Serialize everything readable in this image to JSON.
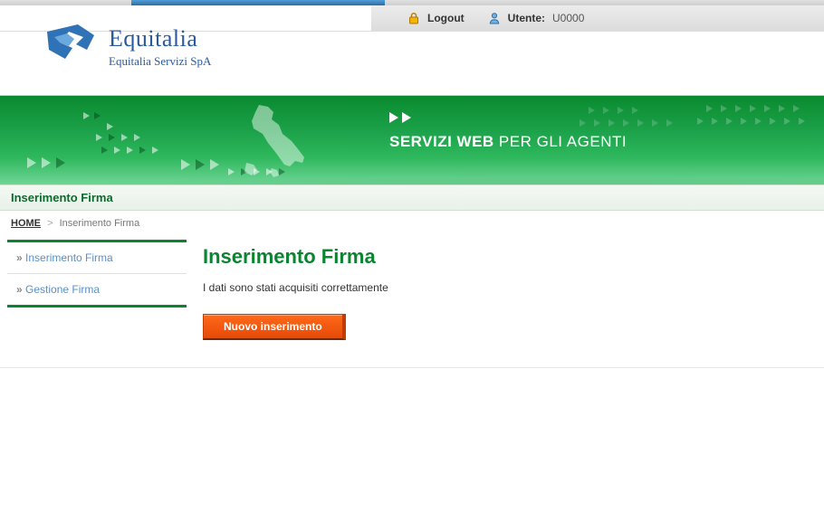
{
  "top": {
    "logout_label": "Logout",
    "utente_label": "Utente:",
    "utente_value": "U0000"
  },
  "brand": {
    "name": "Equitalia",
    "subtitle": "Equitalia Servizi SpA"
  },
  "banner": {
    "title_strong": "SERVIZI WEB",
    "title_rest": " PER GLI AGENTI"
  },
  "section": {
    "title": "Inserimento Firma"
  },
  "breadcrumb": {
    "home": "HOME",
    "current": "Inserimento Firma"
  },
  "sidebar": {
    "items": [
      {
        "label": "Inserimento Firma"
      },
      {
        "label": "Gestione Firma"
      }
    ]
  },
  "main": {
    "heading": "Inserimento Firma",
    "message": "I dati sono stati acquisiti correttamente",
    "button_label": "Nuovo inserimento"
  },
  "colors": {
    "brand_blue": "#2a5a9e",
    "green": "#0a8431",
    "orange": "#e74a08"
  }
}
